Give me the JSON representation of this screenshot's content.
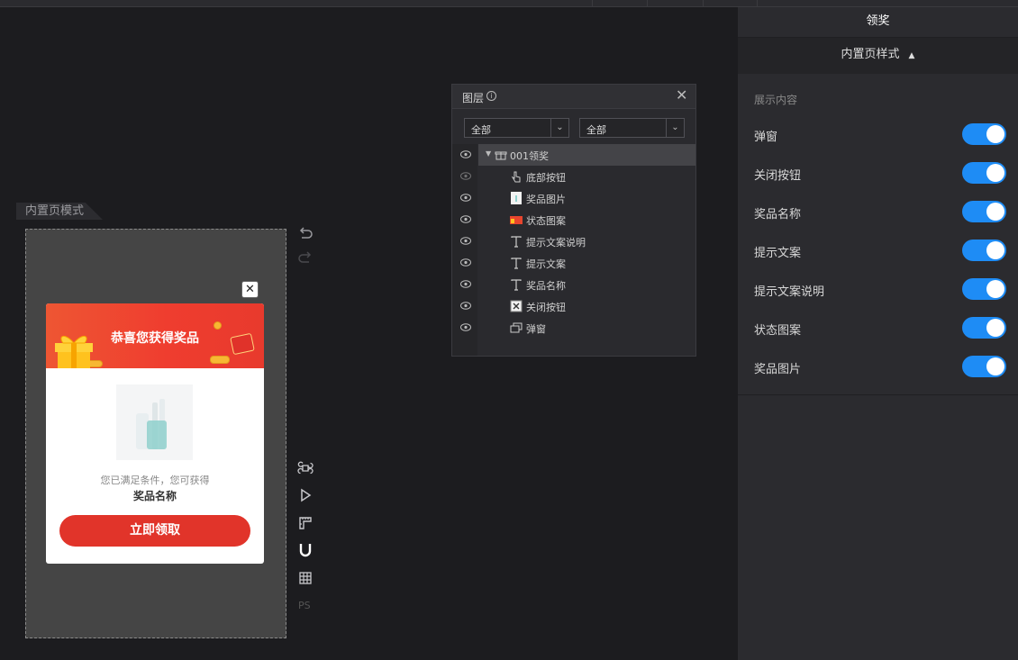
{
  "canvas": {
    "mode_label": "内置页模式"
  },
  "popup": {
    "close_glyph": "✕",
    "title": "恭喜您获得奖品",
    "hint": "您已满足条件，您可获得",
    "prize_name": "奖品名称",
    "claim_button": "立即领取"
  },
  "tools": {
    "ps_label": "PS",
    "icons": [
      "undo-icon",
      "redo-icon",
      "command-icon",
      "play-icon",
      "ruler-icon",
      "magnet-icon",
      "grid-icon"
    ]
  },
  "layers_panel": {
    "title": "图层",
    "info_glyph": "i",
    "close_glyph": "✕",
    "filter_left": "全部",
    "filter_right": "全部",
    "root_layer": "001领奖",
    "items": [
      {
        "label": "底部按钮",
        "icon": "pointer-icon"
      },
      {
        "label": "奖品图片",
        "icon": "image-icon"
      },
      {
        "label": "状态图案",
        "icon": "image-thumb-icon"
      },
      {
        "label": "提示文案说明",
        "icon": "text-icon"
      },
      {
        "label": "提示文案",
        "icon": "text-icon"
      },
      {
        "label": "奖品名称",
        "icon": "text-icon"
      },
      {
        "label": "关闭按钮",
        "icon": "close-box-icon"
      },
      {
        "label": "弹窗",
        "icon": "layers-icon"
      }
    ]
  },
  "right_panel": {
    "title": "领奖",
    "section": "内置页样式",
    "sub_heading": "展示内容",
    "accent": "#1e8cf5",
    "toggles": [
      {
        "label": "弹窗",
        "on": true
      },
      {
        "label": "关闭按钮",
        "on": true
      },
      {
        "label": "奖品名称",
        "on": true
      },
      {
        "label": "提示文案",
        "on": true
      },
      {
        "label": "提示文案说明",
        "on": true
      },
      {
        "label": "状态图案",
        "on": true
      },
      {
        "label": "奖品图片",
        "on": true
      }
    ]
  }
}
